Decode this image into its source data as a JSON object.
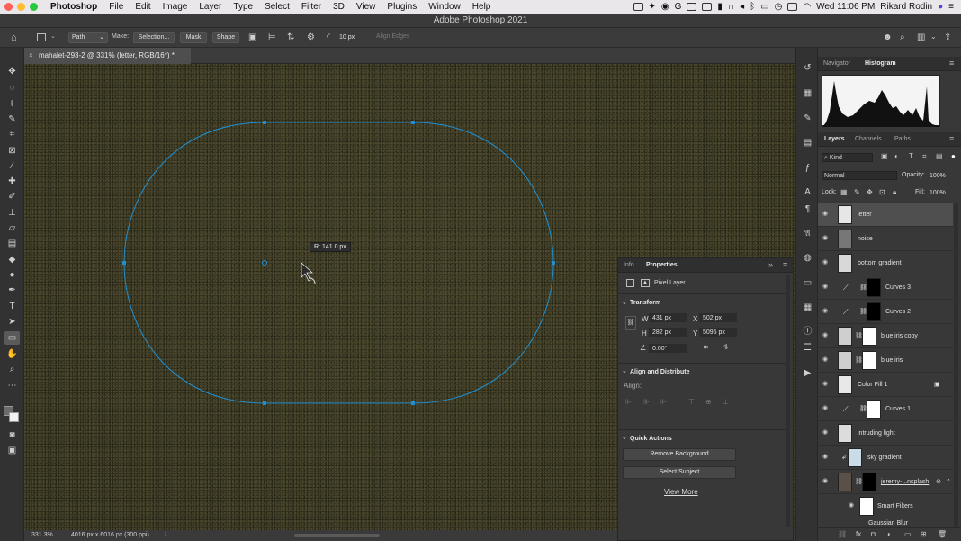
{
  "menubar": {
    "app": "Photoshop",
    "items": [
      "File",
      "Edit",
      "Image",
      "Layer",
      "Type",
      "Select",
      "Filter",
      "3D",
      "View",
      "Plugins",
      "Window",
      "Help"
    ],
    "clock": "Wed 11:06 PM",
    "user": "Rikard Rodin"
  },
  "window": {
    "title": "Adobe Photoshop 2021"
  },
  "options": {
    "mode": "Path",
    "make_label": "Make:",
    "selection": "Selection...",
    "mask": "Mask",
    "shape": "Shape",
    "radius": "10 px",
    "align_edges": "Align Edges"
  },
  "document": {
    "tab_title": "mahalet-293-2 @ 331% (letter, RGB/16*) *",
    "tooltip": "R: 141.0 px",
    "zoom": "331.3%",
    "doc_info": "4016 px x 6016 px (300 ppi)"
  },
  "properties": {
    "tabs": [
      "Info",
      "Properties"
    ],
    "layer_kind": "Pixel Layer",
    "transform_title": "Transform",
    "w_label": "W",
    "w": "431 px",
    "x_label": "X",
    "x": "502 px",
    "h_label": "H",
    "h": "282 px",
    "y_label": "Y",
    "y": "5095 px",
    "angle": "0.00°",
    "align_title": "Align and Distribute",
    "align_label": "Align:",
    "more": "...",
    "quick_title": "Quick Actions",
    "remove_bg": "Remove Background",
    "select_subject": "Select Subject",
    "view_more": "View More"
  },
  "panels": {
    "top_tabs": [
      "Navigator",
      "Histogram"
    ],
    "layer_tabs": [
      "Layers",
      "Channels",
      "Paths"
    ],
    "kind": "Kind",
    "blend_mode": "Normal",
    "opacity_label": "Opacity:",
    "opacity": "100%",
    "lock_label": "Lock:",
    "fill_label": "Fill:",
    "fill": "100%"
  },
  "layers": [
    {
      "name": "letter",
      "selected": true
    },
    {
      "name": "noise"
    },
    {
      "name": "bottom gradient"
    },
    {
      "name": "Curves 3"
    },
    {
      "name": "Curves 2"
    },
    {
      "name": "blue iris copy"
    },
    {
      "name": "blue iris"
    },
    {
      "name": "Color Fill 1"
    },
    {
      "name": "Curves 1"
    },
    {
      "name": "intruding light"
    },
    {
      "name": "sky gradient"
    },
    {
      "name": "jeremy-...nsplash"
    },
    {
      "name": "Smart Filters"
    },
    {
      "name": "Gaussian Blur"
    }
  ],
  "colors": {
    "path": "#1f8fd1",
    "canvas": "#3e3b25",
    "panel": "#383838"
  }
}
